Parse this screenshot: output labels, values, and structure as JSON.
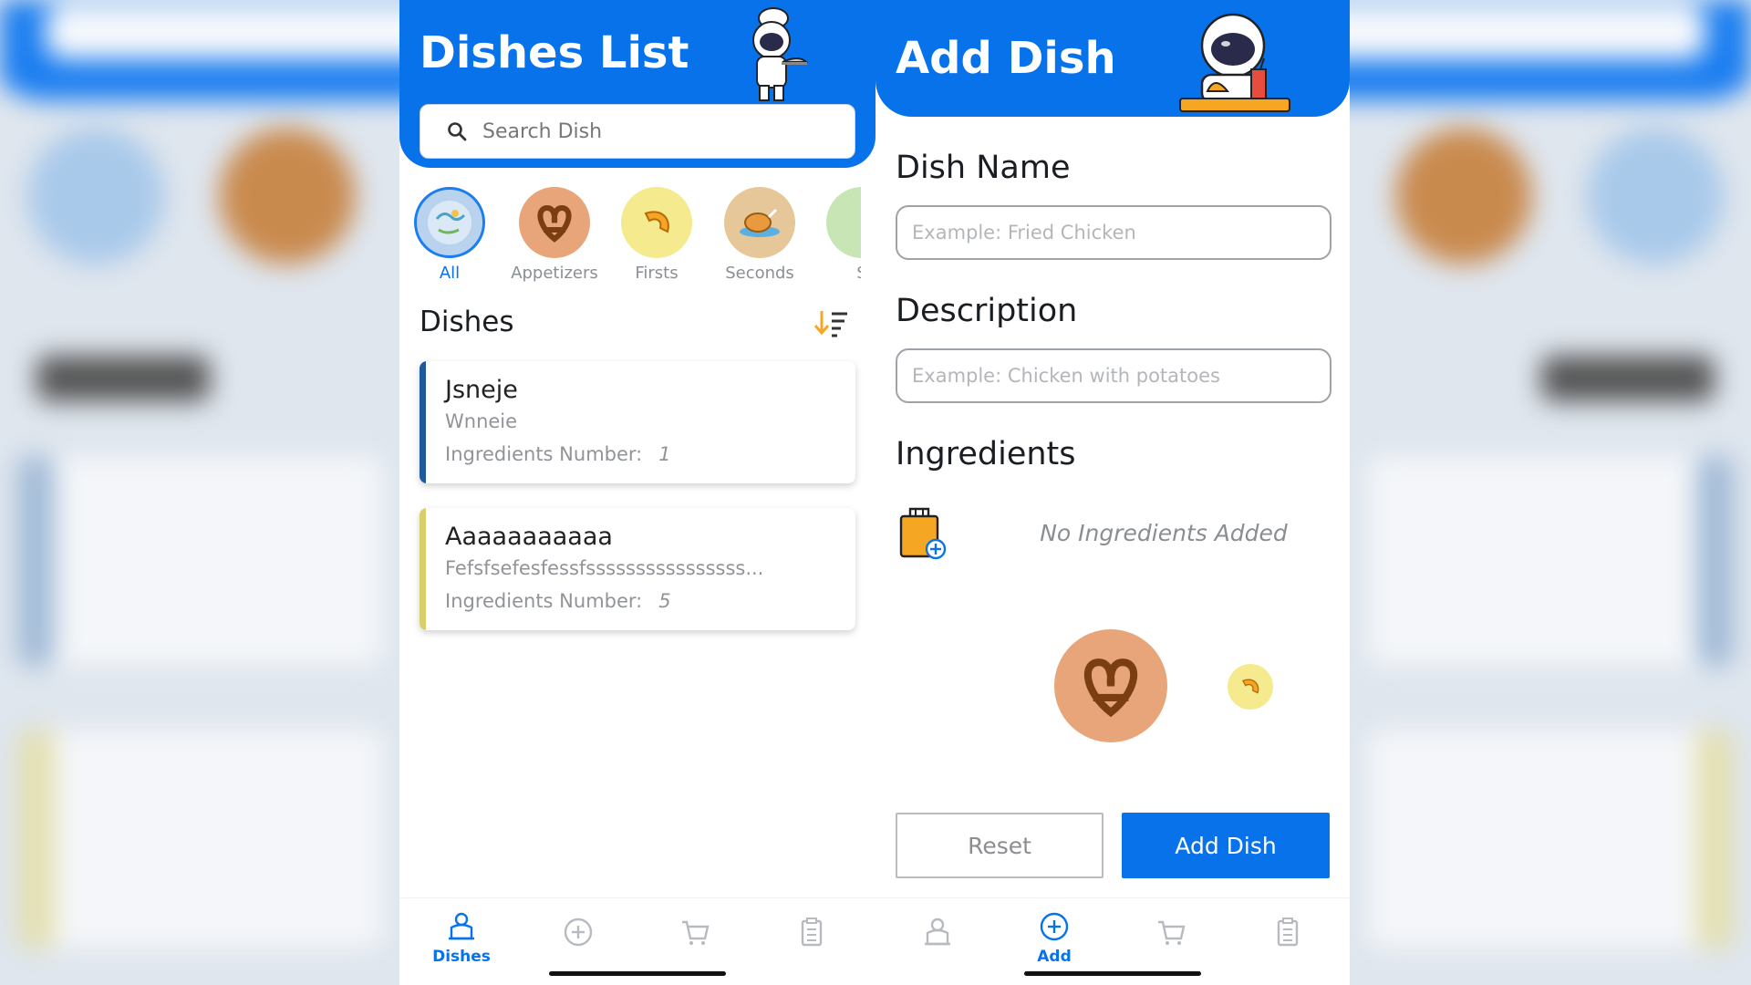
{
  "left": {
    "title": "Dishes List",
    "search_placeholder": "Search Dish",
    "categories": [
      {
        "label": "All",
        "color": "#b9d3ee"
      },
      {
        "label": "Appetizers",
        "color": "#e8a57a"
      },
      {
        "label": "Firsts",
        "color": "#f5ea8e"
      },
      {
        "label": "Seconds",
        "color": "#e6c79a"
      },
      {
        "label": "S",
        "color": "#c8e6b5"
      }
    ],
    "section_title": "Dishes",
    "dishes": [
      {
        "name": "Jsneje",
        "description": "Wnneie",
        "ingredients_label": "Ingredients Number:",
        "ingredients_count": "1",
        "accent": "#1f5b9c"
      },
      {
        "name": "Aaaaaaaaaaa",
        "description": "Fefsfsefesfessfssssssssssssssss...",
        "ingredients_label": "Ingredients Number:",
        "ingredients_count": "5",
        "accent": "#d8cf6a"
      }
    ],
    "nav": {
      "dishes": "Dishes"
    }
  },
  "right": {
    "title": "Add Dish",
    "dish_name_label": "Dish Name",
    "dish_name_placeholder": "Example: Fried Chicken",
    "description_label": "Description",
    "description_placeholder": "Example: Chicken with potatoes",
    "ingredients_label": "Ingredients",
    "no_ingredients": "No Ingredients Added",
    "reset_label": "Reset",
    "add_label": "Add Dish",
    "nav": {
      "add": "Add"
    }
  },
  "colors": {
    "primary": "#0872ea",
    "accent_orange": "#f5a623"
  },
  "icons": [
    "search-icon",
    "sort-icon",
    "chef-astronaut-icon",
    "astronaut-food-icon",
    "pretzel-icon",
    "macaroni-icon",
    "chicken-icon",
    "salad-icon",
    "add-ingredient-icon",
    "dishes-nav-icon",
    "add-nav-icon",
    "cart-icon",
    "checklist-icon"
  ]
}
